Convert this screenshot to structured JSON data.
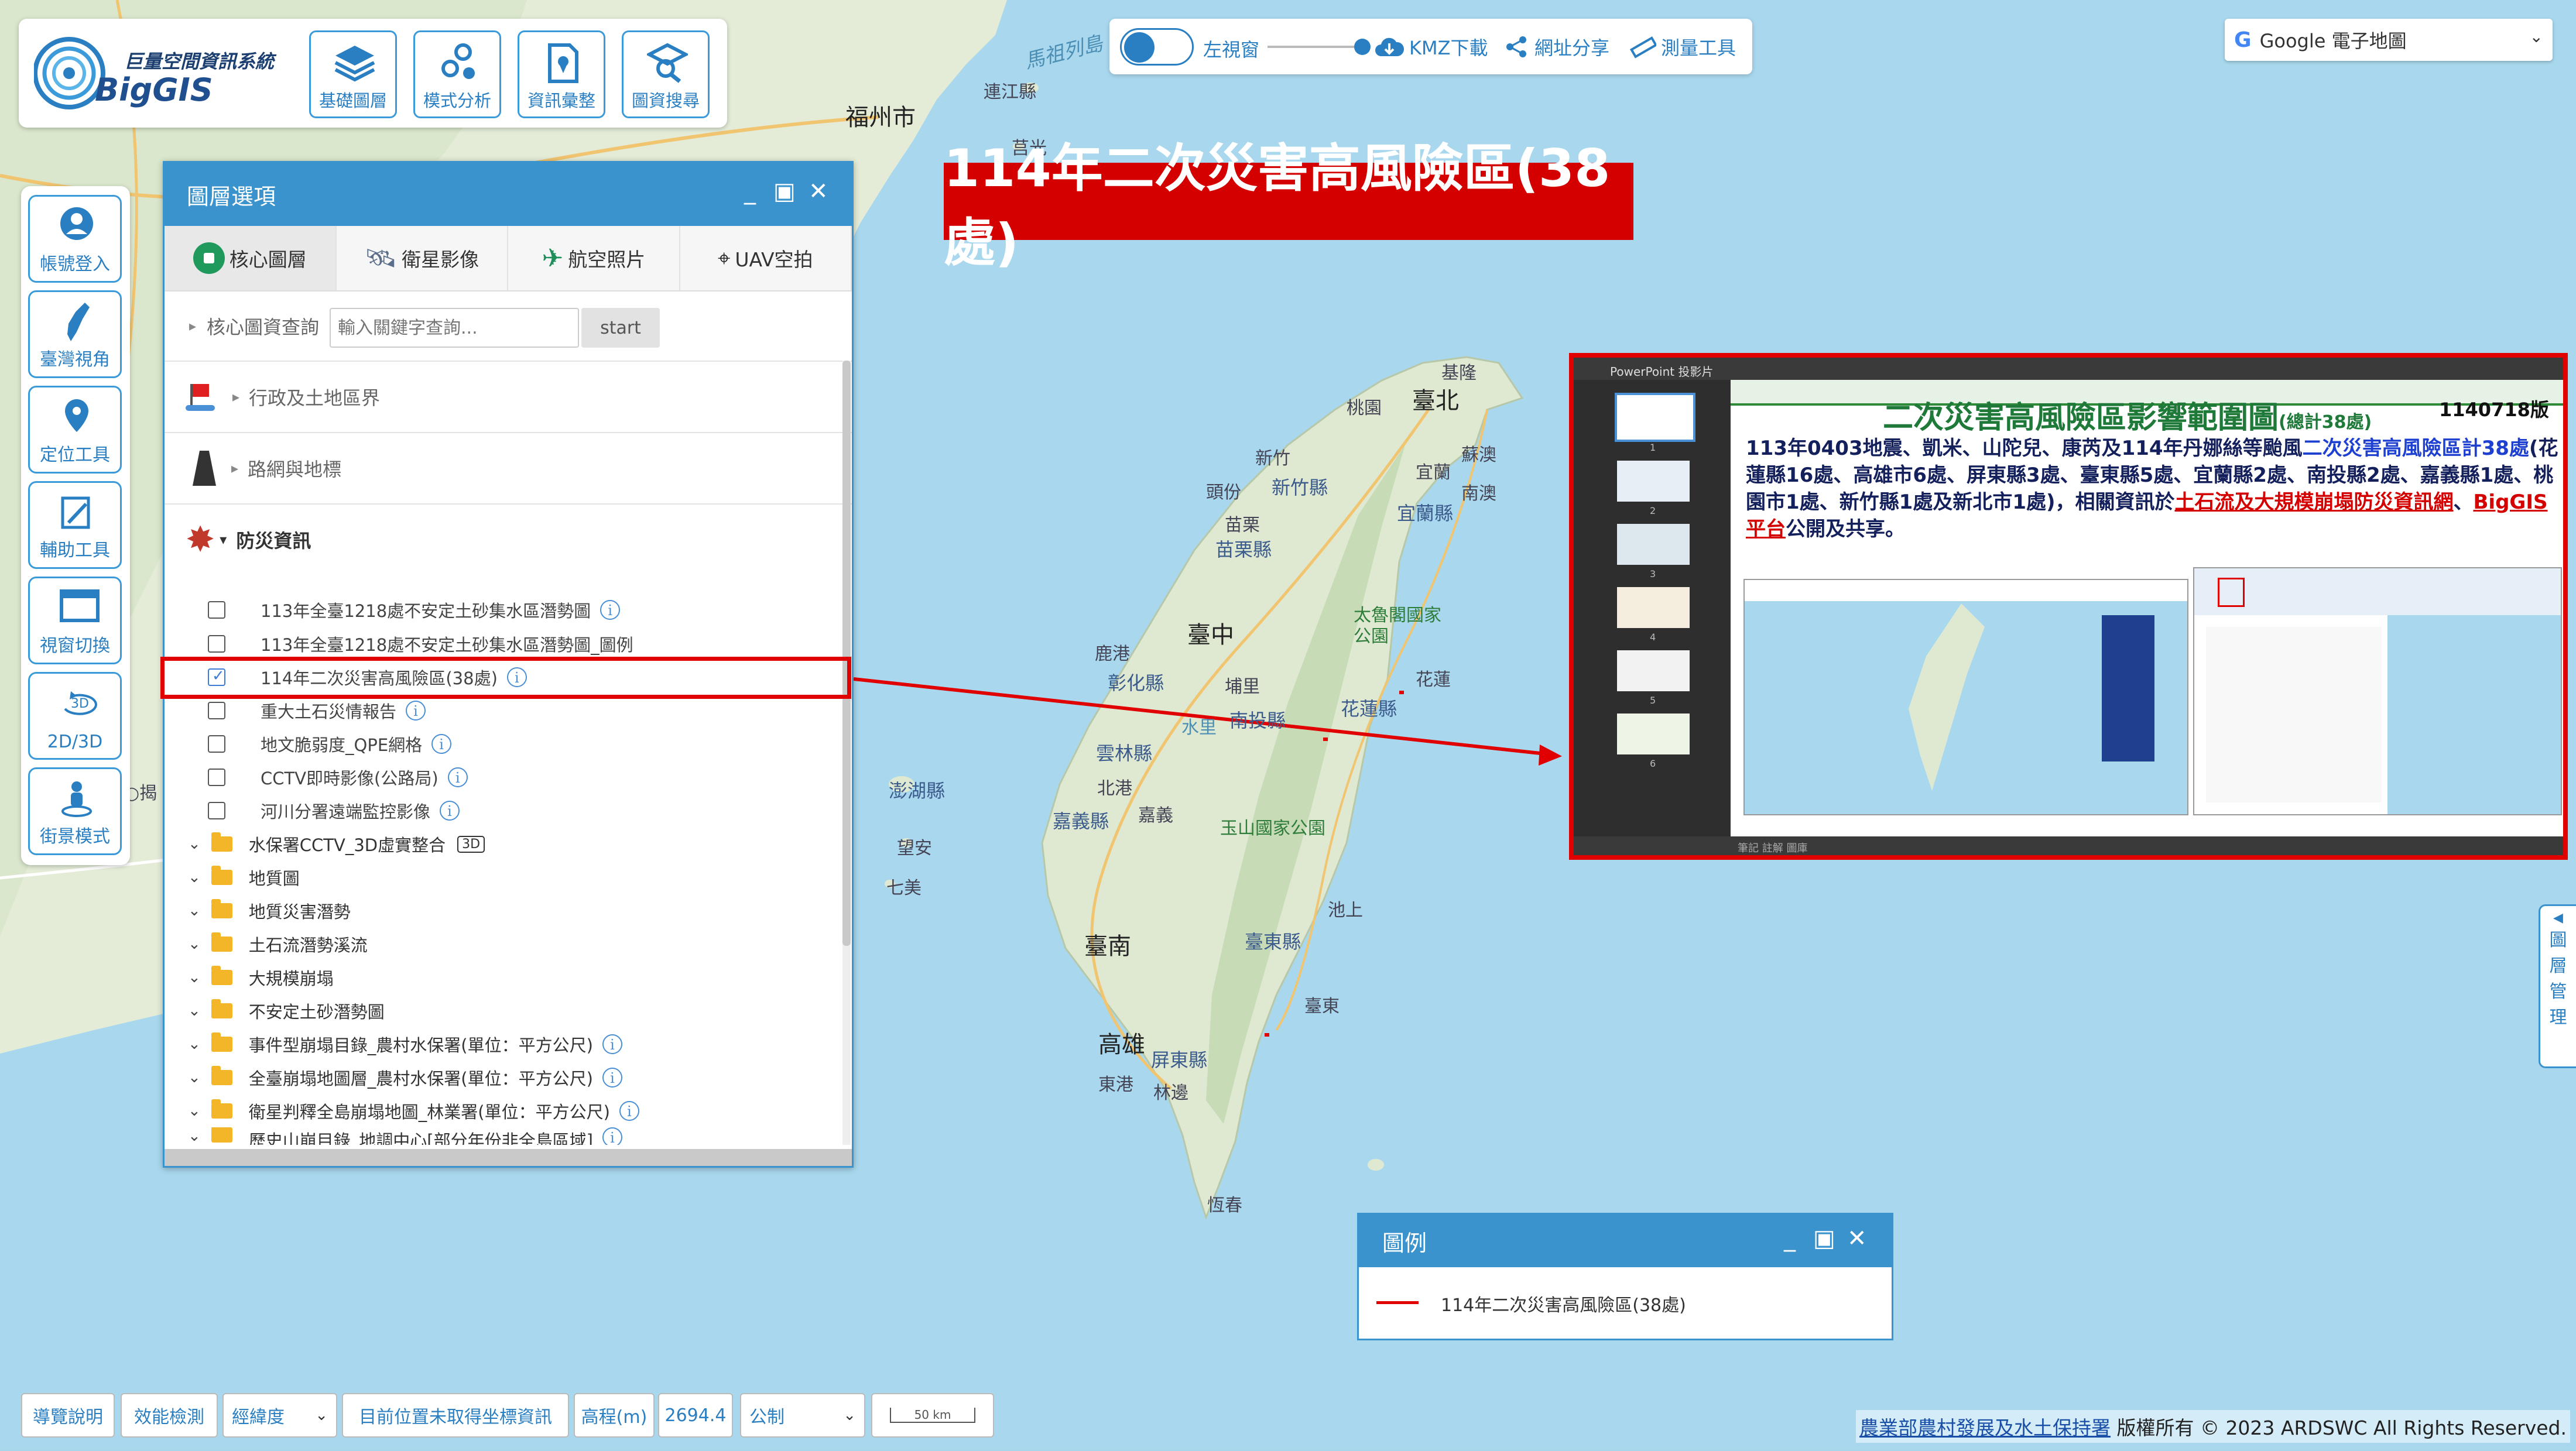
{
  "logo": {
    "title": "巨量空間資訊系統",
    "name": "BigGIS"
  },
  "top_tools": [
    {
      "label": "基礎圖層",
      "icon": "layers-icon"
    },
    {
      "label": "模式分析",
      "icon": "model-icon"
    },
    {
      "label": "資訊彙整",
      "icon": "doc-map-icon"
    },
    {
      "label": "圖資搜尋",
      "icon": "map-search-icon"
    }
  ],
  "top_bar": {
    "split_label": "左視窗",
    "kmz_label": "KMZ下載",
    "share_label": "網址分享",
    "measure_label": "測量工具"
  },
  "basemap": {
    "selected": "Google 電子地圖"
  },
  "side_tools": [
    {
      "label": "帳號登入",
      "icon": "user-icon"
    },
    {
      "label": "臺灣視角",
      "icon": "taiwan-icon"
    },
    {
      "label": "定位工具",
      "icon": "location-pin-icon"
    },
    {
      "label": "輔助工具",
      "icon": "tools-icon"
    },
    {
      "label": "視窗切換",
      "icon": "window-icon"
    },
    {
      "label": "2D/3D",
      "icon": "3d-rotate-icon"
    },
    {
      "label": "街景模式",
      "icon": "street-view-icon"
    }
  ],
  "side_3d_text": "3D",
  "layer_panel": {
    "title": "圖層選項",
    "tabs": [
      "核心圖層",
      "衛星影像",
      "航空照片",
      "UAV空拍"
    ],
    "search_label": "核心圖資查詢",
    "search_placeholder": "輸入關鍵字查詢...",
    "search_button": "start",
    "sections": [
      "行政及土地區界",
      "路網與地標",
      "防災資訊"
    ],
    "layers": [
      {
        "label": "113年全臺1218處不安定土砂集水區潛勢圖",
        "checked": false
      },
      {
        "label": "113年全臺1218處不安定土砂集水區潛勢圖_圖例",
        "checked": false
      },
      {
        "label": "114年二次災害高風險區(38處)",
        "checked": true
      },
      {
        "label": "重大土石災情報告",
        "checked": false
      },
      {
        "label": "地文脆弱度_QPE網格",
        "checked": false
      },
      {
        "label": "CCTV即時影像(公路局)",
        "checked": false
      },
      {
        "label": "河川分署遠端監控影像",
        "checked": false
      }
    ],
    "folders": [
      "水保署CCTV_3D虛實整合",
      "地質圖",
      "地質災害潛勢",
      "土石流潛勢溪流",
      "大規模崩塌",
      "不安定土砂潛勢圖",
      "事件型崩塌目錄_農村水保署(單位：平方公尺)",
      "全臺崩塌地圖層_農村水保署(單位：平方公尺)",
      "衛星判釋全島崩塌地圖_林業署(單位：平方公尺)",
      "歷史山崩目錄_地調中心[部分年份非全島區域]"
    ],
    "badge_3d": "3D"
  },
  "banner": {
    "text": "114年二次災害高風險區(38處)"
  },
  "preview": {
    "app": "PowerPoint 投影片",
    "slide_title": "二次災害高風險區影響範圍圖",
    "slide_title_suffix": "(總計38處)",
    "version": "1140718版",
    "line1_a": "113年0403地震、凱米、山陀兒、康芮及114年丹娜絲等颱風",
    "line1_b": "二次災害高風險區計38處",
    "line2": "(花蓮縣16處、高雄市6處、屏東縣3處、臺東縣5處、宜蘭縣2處、南投縣2處、嘉義縣1處、桃園市1處、新竹縣1處及新北市1處)，相關資訊於",
    "line3_a": "土石流及大規模崩塌防災資訊網",
    "line3_sep": "、",
    "line3_b": "BigGIS平台",
    "line3_c": "公開及共享。",
    "thumbs": [
      "1",
      "2",
      "3",
      "4",
      "5",
      "6"
    ],
    "status": "筆記  註解  圖庫"
  },
  "legend": {
    "title": "圖例",
    "item": "114年二次災害高風險區(38處)",
    "line_color": "#e00000"
  },
  "right_tab": {
    "label": [
      "圖",
      "層",
      "管",
      "理"
    ],
    "arrow": "◀"
  },
  "bottom": {
    "guide": "導覽說明",
    "perf": "效能檢測",
    "coord_type": "經緯度",
    "position": "目前位置未取得坐標資訊",
    "elev_label": "高程(m)",
    "elev_value": "2694.4",
    "unit": "公制",
    "scale": "50 km"
  },
  "footer": {
    "org": "農業部農村發展及水土保持署",
    "copy": " 版權所有 © 2023 ARDSWC All Rights Reserved."
  },
  "map_labels": {
    "fuzhou": "福州市",
    "lianjiang": "連江縣",
    "jinguang": "莒光",
    "mazu": "馬祖列島",
    "keelung": "基隆",
    "taipei": "臺北",
    "taoyuan": "桃園",
    "hsinchu": "新竹",
    "hsinchu_county": "新竹縣",
    "toufen": "頭份",
    "miaoli": "苗栗",
    "miaoli_county": "苗栗縣",
    "yilan": "宜蘭",
    "yilan_county": "宜蘭縣",
    "suao": "蘇澳",
    "nanao": "南澳",
    "taichung": "臺中",
    "changhua": "鹿港",
    "changhua_county": "彰化縣",
    "puli": "埔里",
    "nantou": "南投縣",
    "taroko": "太魯閣國家公園",
    "hualien": "花蓮",
    "hualien_county": "花蓮縣",
    "shuili": "水里",
    "yunlin": "雲林縣",
    "chiayi": "北港",
    "chiayi_county": "嘉義縣",
    "chiayi_city": "嘉義",
    "yushan": "玉山國家公園",
    "penghu": "澎湖縣",
    "wangan": "望安",
    "qimei": "七美",
    "chishang": "池上",
    "tainan": "臺南",
    "taitung": "臺東縣",
    "taitung_city": "臺東",
    "kaohsiung": "高雄",
    "pingtung": "屏東縣",
    "donggang": "東港",
    "linbian": "林邊",
    "hengchun": "恆春",
    "xiamen": "○揭"
  }
}
